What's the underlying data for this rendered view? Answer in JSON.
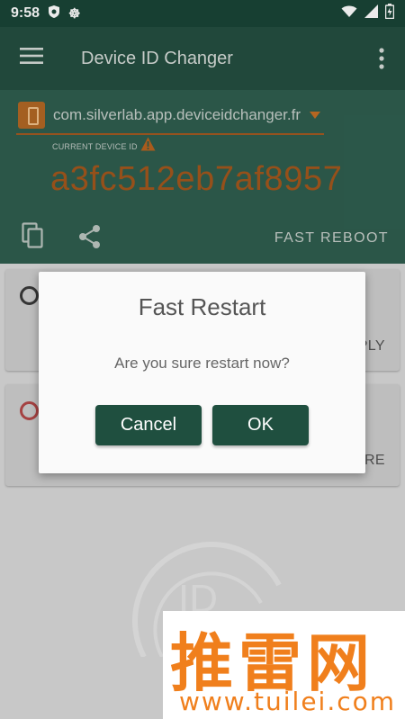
{
  "status_bar": {
    "time": "9:58"
  },
  "app_bar": {
    "title": "Device ID Changer"
  },
  "header": {
    "package_name": "com.silverlab.app.deviceidchanger.fr",
    "current_id_label": "CURRENT DEVICE ID",
    "device_id": "a3fc512eb7af8957",
    "fast_reboot_label": "FAST REBOOT"
  },
  "cards": [
    {
      "action_label": "PLY"
    },
    {
      "action_label": "RE"
    }
  ],
  "dialog": {
    "title": "Fast Restart",
    "message": "Are you sure restart now?",
    "cancel_label": "Cancel",
    "ok_label": "OK"
  },
  "watermark": {
    "chinese": "推雷网",
    "url": "www.tuilei.com"
  },
  "colors": {
    "app_bar": "#244f40",
    "header": "#2f5e4f",
    "accent": "#a3571d",
    "button": "#1f4f3f"
  },
  "icons": [
    "menu-icon",
    "overflow-icon",
    "package-icon",
    "dropdown-arrow-icon",
    "warning-icon",
    "copy-icon",
    "share-icon",
    "wifi-icon",
    "signal-icon",
    "battery-icon"
  ]
}
